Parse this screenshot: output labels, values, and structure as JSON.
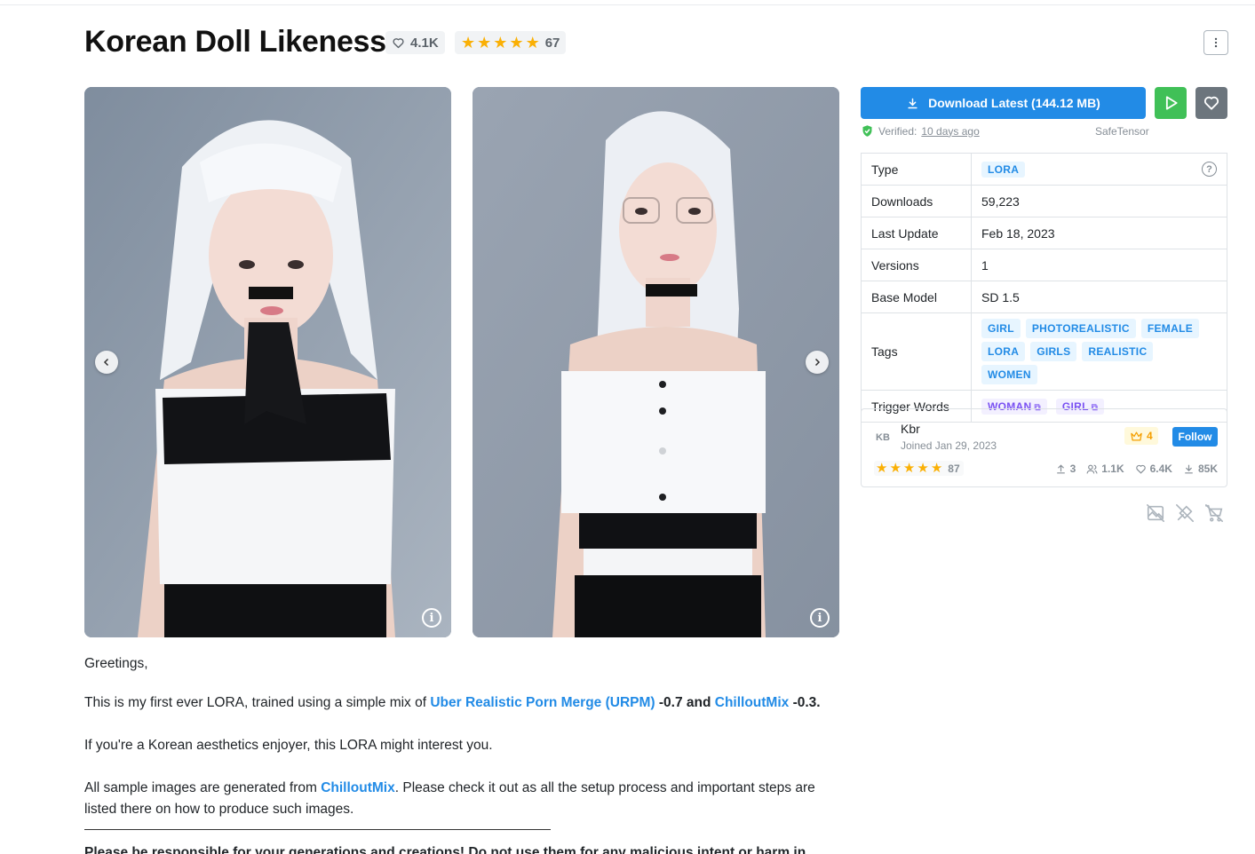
{
  "header": {
    "title": "Korean Doll Likeness",
    "likes": "4.1K",
    "rating_count": "67",
    "star_count": 5,
    "more_icon": "dots-vertical-icon"
  },
  "gallery": {
    "prev_icon": "chevron-left-icon",
    "next_icon": "chevron-right-icon",
    "info_icon": "info-circle-icon"
  },
  "description": {
    "greeting": "Greetings,",
    "line1_pre": "This is my first ever LORA, trained using a simple mix of ",
    "line1_link1": "Uber Realistic Porn Merge (URPM)",
    "line1_mid": " -0.7 and ",
    "line1_link2": "ChilloutMix",
    "line1_post": " -0.3.",
    "line2": "If you're a Korean aesthetics enjoyer, this LORA might interest you.",
    "line3_pre": "All sample images are generated from ",
    "line3_link": "ChilloutMix",
    "line3_post": ". Please check it out as all the setup process and important steps are listed there on how to produce such images.",
    "warning": "Please be responsible for your generations and creations! Do not use them for any malicious intent or harm in"
  },
  "actions": {
    "download_label": "Download Latest (144.12 MB)",
    "verified_label": "Verified:",
    "verified_when": "10 days ago",
    "format": "SafeTensor"
  },
  "details": {
    "type_label": "Type",
    "type_value": "LORA",
    "downloads_label": "Downloads",
    "downloads_value": "59,223",
    "last_update_label": "Last Update",
    "last_update_value": "Feb 18, 2023",
    "versions_label": "Versions",
    "versions_value": "1",
    "base_model_label": "Base Model",
    "base_model_value": "SD 1.5",
    "tags_label": "Tags",
    "tags": [
      "GIRL",
      "PHOTOREALISTIC",
      "FEMALE",
      "LORA",
      "GIRLS",
      "REALISTIC",
      "WOMEN"
    ],
    "trigger_label": "Trigger Words",
    "trigger_words": [
      "WOMAN",
      "GIRL"
    ]
  },
  "creator": {
    "initials": "KB",
    "name": "Kbr",
    "joined": "Joined Jan 29, 2023",
    "rank": "4",
    "follow_label": "Follow",
    "rating_count": "87",
    "uploads": "3",
    "followers": "1.1K",
    "favorites": "6.4K",
    "downloads": "85K"
  },
  "colors": {
    "accent": "#228be6",
    "play": "#40c057",
    "star": "#fab005"
  }
}
